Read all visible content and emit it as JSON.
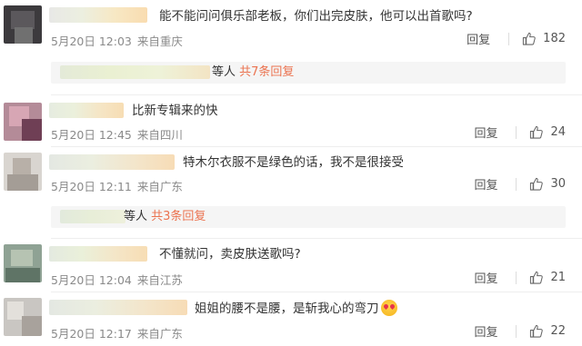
{
  "colors": {
    "accent": "#eb7350",
    "meta": "#8a8a8a",
    "text": "#333333"
  },
  "comments": [
    {
      "text": "能不能问问俱乐部老板，你们出完皮肤，他可以出首歌吗?",
      "date": "5月20日 12:03",
      "source": "来自重庆",
      "reply_label": "回复",
      "likes": "182",
      "sub_replies": {
        "suffix": "等人",
        "more": "共7条回复"
      }
    },
    {
      "text": "比新专辑来的快",
      "date": "5月20日 12:45",
      "source": "来自四川",
      "reply_label": "回复",
      "likes": "24"
    },
    {
      "text": "特木尔衣服不是绿色的话，我不是很接受",
      "date": "5月20日 12:11",
      "source": "来自广东",
      "reply_label": "回复",
      "likes": "30",
      "sub_replies": {
        "suffix": "等人",
        "more": "共3条回复"
      }
    },
    {
      "text": "不懂就问，卖皮肤送歌吗?",
      "date": "5月20日 12:04",
      "source": "来自江苏",
      "reply_label": "回复",
      "likes": "21"
    },
    {
      "text": "姐姐的腰不是腰，是斩我心的弯刀",
      "date": "5月20日 12:17",
      "source": "来自广东",
      "reply_label": "回复",
      "likes": "22"
    }
  ],
  "icons": {
    "like": "thumbs-up-icon",
    "emoji": "heart-eyes-emoji-icon"
  }
}
